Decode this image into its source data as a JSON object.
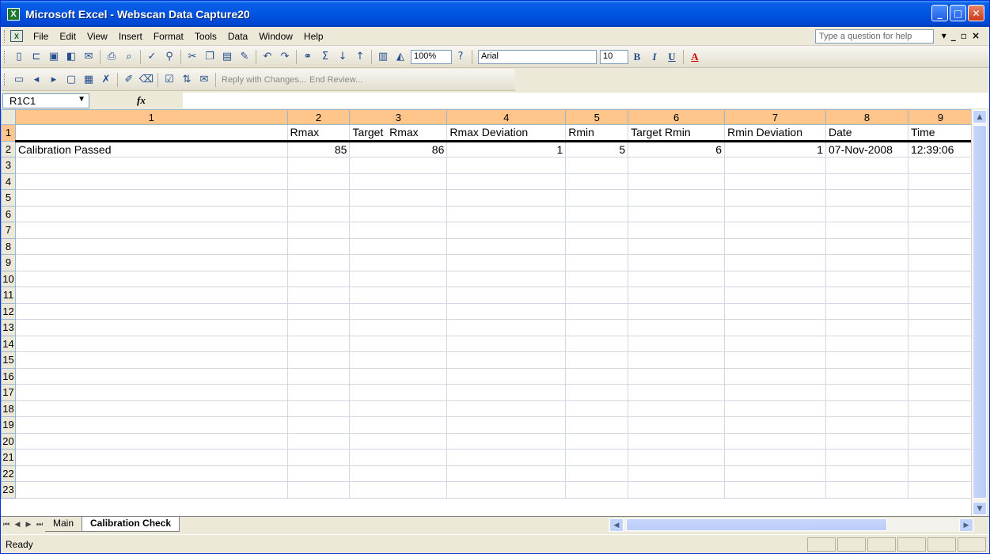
{
  "window": {
    "title": "Microsoft Excel - Webscan Data Capture20",
    "app_icon": "excel-icon"
  },
  "menubar": {
    "items": [
      "File",
      "Edit",
      "View",
      "Insert",
      "Format",
      "Tools",
      "Data",
      "Window",
      "Help"
    ],
    "help_placeholder": "Type a question for help"
  },
  "toolbar": {
    "zoom": "100%",
    "font": "Arial",
    "font_size": "10"
  },
  "review_toolbar": {
    "reply_label": "Reply with Changes...",
    "end_review_label": "End Review..."
  },
  "formula_bar": {
    "name_box": "R1C1",
    "fx_label": "fx",
    "formula": ""
  },
  "sheet": {
    "column_headers": [
      "1",
      "2",
      "3",
      "4",
      "5",
      "6",
      "7",
      "8",
      "9"
    ],
    "row_headers": [
      "1",
      "2",
      "3",
      "4",
      "5",
      "6",
      "7",
      "8",
      "9",
      "10",
      "11",
      "12",
      "13",
      "14",
      "15",
      "16",
      "17",
      "18",
      "19",
      "20",
      "21",
      "22",
      "23"
    ],
    "rows": [
      [
        "",
        "Rmax",
        "Target  Rmax",
        "Rmax Deviation",
        "Rmin",
        "Target Rmin",
        "Rmin Deviation",
        "Date",
        "Time"
      ],
      [
        "Calibration Passed",
        "85",
        "86",
        "1",
        "5",
        "6",
        "1",
        "07-Nov-2008",
        "12:39:06"
      ]
    ]
  },
  "sheet_tabs": [
    {
      "label": "Main",
      "active": false
    },
    {
      "label": "Calibration Check",
      "active": true
    }
  ],
  "status": {
    "text": "Ready"
  },
  "colors": {
    "accent": "#0054e3",
    "header_highlight": "#ffc58a"
  }
}
